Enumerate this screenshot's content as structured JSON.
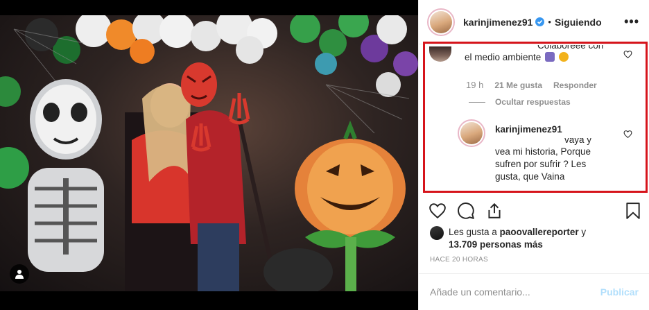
{
  "post": {
    "username": "karinjimenez91",
    "separator": "•",
    "follow_label": "Siguiendo",
    "more_label": "•••"
  },
  "comment1": {
    "text_cut": "Colaboreee con",
    "text": "el medio ambiente",
    "time": "19 h",
    "likes": "21 Me gusta",
    "reply_label": "Responder",
    "hide_replies_label": "Ocultar respuestas"
  },
  "comment2": {
    "username": "karinjimenez91",
    "text_clip": "vaya y",
    "text": "vea mi historia, Porque sufren por sufrir ? Les gusta, que Vaina"
  },
  "likes": {
    "prefix": "Les gusta a",
    "user": "paoovallereporter",
    "conj": "y",
    "others": "13.709 personas más"
  },
  "timestamp": "HACE 20 HORAS",
  "composer": {
    "placeholder": "Añade un comentario...",
    "publish_label": "Publicar"
  },
  "icons": [
    "verified-icon",
    "heart-icon",
    "comment-icon",
    "share-icon",
    "bookmark-icon",
    "user-tag-icon",
    "more-icon"
  ],
  "colors": {
    "highlight_border": "#d6141b",
    "verified": "#3897f0",
    "publish_disabled": "#b2dffc",
    "muted_text": "#8e8e8e"
  }
}
